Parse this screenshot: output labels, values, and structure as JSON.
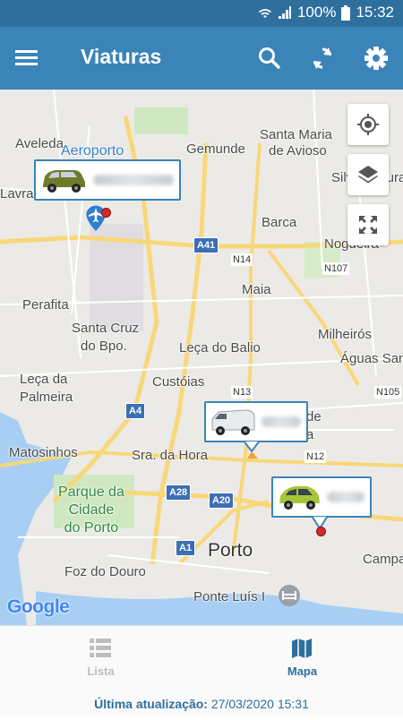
{
  "status_bar": {
    "battery": "100%",
    "time": "15:32"
  },
  "app_bar": {
    "title": "Viaturas",
    "icons": [
      "menu-icon",
      "search-icon",
      "refresh-icon",
      "settings-icon"
    ]
  },
  "map": {
    "places": {
      "aveleda": "Aveleda",
      "aeroporto": "Aeroporto",
      "lavra": "Lavra",
      "gemunde": "Gemunde",
      "santa_maria_1": "Santa Maria",
      "santa_maria_2": "de Avioso",
      "silva_escura": "Silva Escura",
      "barca": "Barca",
      "nogueira": "Nogueira",
      "maia": "Maia",
      "perafita": "Perafita",
      "santa_cruz_1": "Santa Cruz",
      "santa_cruz_2": "do Bpo.",
      "leca_balio": "Leça do Balio",
      "milheiros": "Milheirós",
      "aguas_santas": "Águas Santas",
      "leca_1": "Leça da",
      "leca_2": "Palmeira",
      "custoias": "Custóias",
      "matosinhos": "Matosinhos",
      "sra_hora": "Sra. da Hora",
      "parque_1": "Parque da",
      "parque_2": "Cidade",
      "parque_3": "do Porto",
      "porto": "Porto",
      "foz": "Foz do Douro",
      "ponte": "Ponte Luís I",
      "campanha": "Campa",
      "ermesinde_frag": "de",
      "ermesinde_frag2": "a"
    },
    "roads": {
      "a41": "A41",
      "a4": "A4",
      "a28": "A28",
      "a20": "A20",
      "a1": "A1",
      "n14": "N14",
      "n107": "N107",
      "n13": "N13",
      "n105": "N105",
      "n12": "N12"
    },
    "attribution": "Google",
    "buttons": [
      "my-location-icon",
      "layers-icon",
      "fullscreen-icon"
    ],
    "vehicles": [
      "olive-wagon",
      "white-van",
      "lime-hatchback"
    ]
  },
  "bottom_nav": {
    "list_label": "Lista",
    "map_label": "Mapa",
    "active": "Mapa"
  },
  "footer": {
    "label": "Última atualização:",
    "value": "27/03/2020 15:31"
  },
  "colors": {
    "app_bar": "#3a84b8",
    "status_bar": "#2e6f9e",
    "accent": "#2e6f9e",
    "inactive": "#bdbdbd",
    "pin": "#d12b2b",
    "water": "#a8cff3",
    "road": "#f8d77a"
  }
}
